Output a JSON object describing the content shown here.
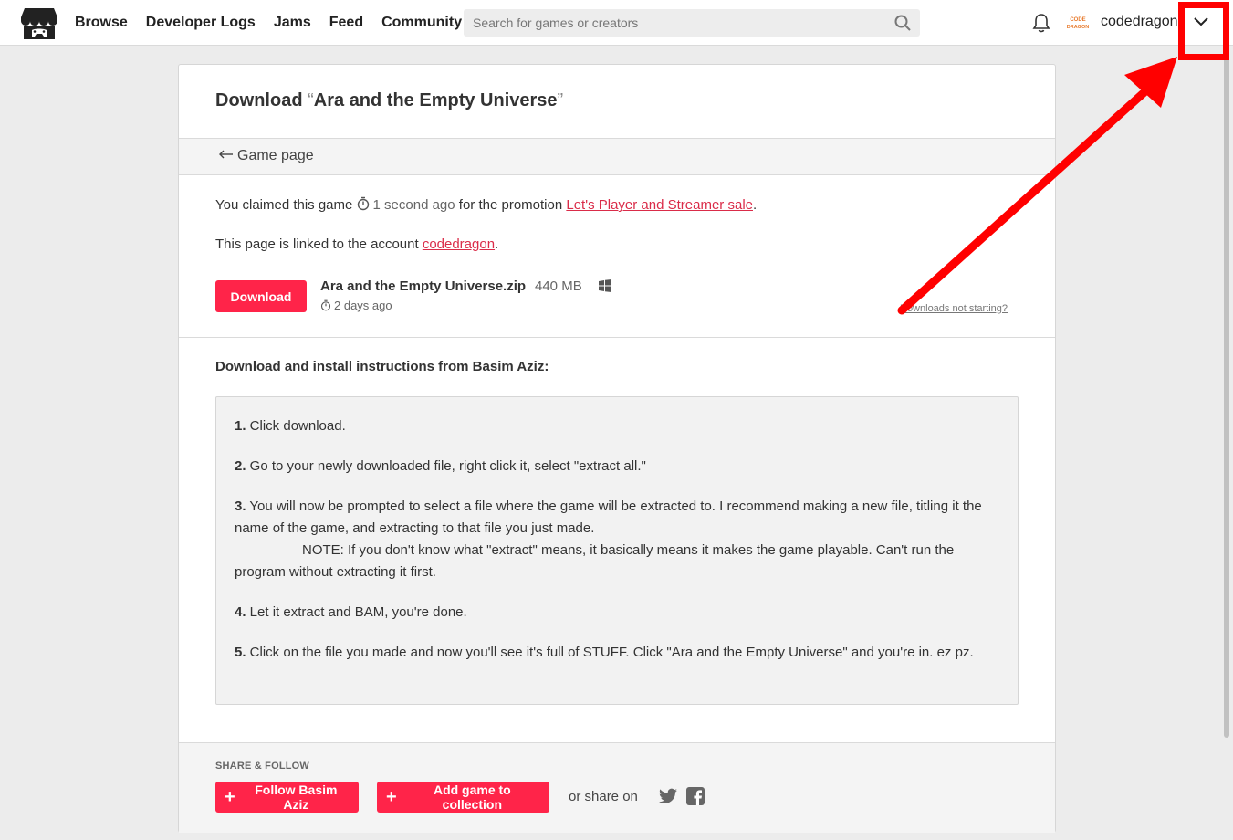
{
  "header": {
    "nav": [
      "Browse",
      "Developer Logs",
      "Jams",
      "Feed",
      "Community"
    ],
    "search_placeholder": "Search for games or creators",
    "username": "codedragon",
    "avatar_text": "CODE DRAGON"
  },
  "card": {
    "title_prefix": "Download ",
    "title_open_quote": "“",
    "title_game": "Ara and the Empty Universe",
    "title_close_quote": "”",
    "back_link": "Game page",
    "claim_text_1": "You claimed this game ",
    "claim_time": "1 second ago",
    "claim_text_2": " for the promotion ",
    "promotion_link": "Let's Player and Streamer sale",
    "claim_text_3": ".",
    "linked_text": "This page is linked to the account ",
    "linked_account": "codedragon",
    "linked_end": ".",
    "download_button": "Download",
    "file_name": "Ara and the Empty Universe.zip",
    "file_size": "440 MB",
    "file_date": "2 days ago",
    "not_starting": "Downloads not starting?",
    "instructions_heading": "Download and install instructions from Basim Aziz:",
    "instructions": {
      "s1_num": "1.",
      "s1_text": " Click download.",
      "s2_num": "2.",
      "s2_text": " Go to your newly downloaded file, right click it, select \"extract all.\"",
      "s3_num": "3.",
      "s3_text": " You will now be prompted to select a file where the game will be extracted to. I recommend making a new file, titling it the name of the game, and extracting to that file you just made.",
      "s3_note": "NOTE: If you don't know what \"extract\" means, it basically means it makes the game playable. Can't run the program without extracting it first.",
      "s4_num": "4.",
      "s4_text": " Let it extract and BAM, you're done.",
      "s5_num": "5.",
      "s5_text": " Click on the file you made and now you'll see it's full of STUFF. Click \"Ara and the Empty Universe\" and you're in. ez pz."
    },
    "share_heading": "SHARE & FOLLOW",
    "follow_button": "Follow Basim Aziz",
    "collection_button": "Add game to collection",
    "or_share": "or share on"
  },
  "colors": {
    "accent": "#ff2449",
    "link": "#da2c49",
    "annotation": "#ff0000"
  },
  "icons": [
    "itchio-logo-icon",
    "search-icon",
    "bell-icon",
    "chevron-down-icon",
    "arrow-left-icon",
    "stopwatch-icon",
    "windows-icon",
    "plus-icon",
    "twitter-icon",
    "facebook-icon"
  ]
}
